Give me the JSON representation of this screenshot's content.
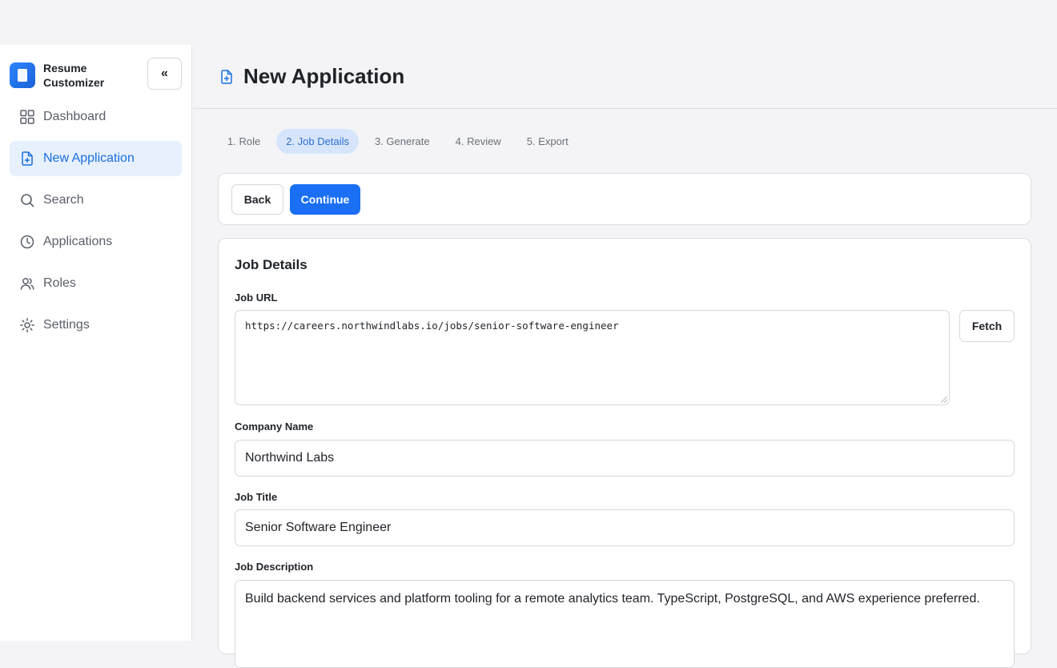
{
  "app": {
    "name": "Resume Customizer",
    "collapse_label": "«"
  },
  "sidebar": {
    "items": [
      {
        "label": "Dashboard",
        "icon": "grid-icon"
      },
      {
        "label": "New Application",
        "icon": "file-plus-icon",
        "active": true
      },
      {
        "label": "Search",
        "icon": "search-icon"
      },
      {
        "label": "Applications",
        "icon": "clock-icon"
      },
      {
        "label": "Roles",
        "icon": "users-icon"
      },
      {
        "label": "Settings",
        "icon": "gear-icon"
      }
    ]
  },
  "header": {
    "title": "New Application",
    "icon": "file-plus-icon"
  },
  "steps": [
    {
      "label": "1. Role"
    },
    {
      "label": "2. Job Details",
      "active": true
    },
    {
      "label": "3. Generate"
    },
    {
      "label": "4. Review"
    },
    {
      "label": "5. Export"
    }
  ],
  "actions": {
    "back_label": "Back",
    "continue_label": "Continue"
  },
  "form": {
    "title": "Job Details",
    "job_url": {
      "label": "Job URL",
      "value": "https://careers.northwindlabs.io/jobs/senior-software-engineer",
      "fetch_label": "Fetch"
    },
    "company_name": {
      "label": "Company Name",
      "value": "Northwind Labs"
    },
    "job_title": {
      "label": "Job Title",
      "value": "Senior Software Engineer"
    },
    "job_description": {
      "label": "Job Description",
      "value": "Build backend services and platform tooling for a remote analytics team. TypeScript, PostgreSQL, and AWS experience preferred."
    }
  },
  "colors": {
    "accent": "#1a6ff5",
    "active_nav_bg": "#e7f0fd",
    "active_step_bg": "#d6e5fb"
  }
}
